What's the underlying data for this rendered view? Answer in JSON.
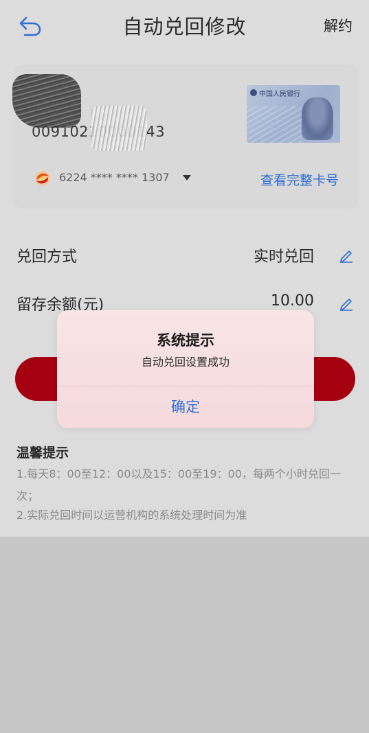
{
  "header": {
    "title": "自动兑回修改",
    "action_label": "解约",
    "back_icon": "back-arrow-icon"
  },
  "card": {
    "account_number": "00910210000143",
    "bank_card_text": "中国人民银行",
    "masked_card": "6224 **** **** 1307",
    "view_full_label": "查看完整卡号",
    "bank_logo_icon": "bank-logo-icon"
  },
  "settings": {
    "method_label": "兑回方式",
    "method_value": "实时兑回",
    "reserve_label": "留存余额(元)",
    "reserve_value": "10.00"
  },
  "tips": {
    "title": "温馨提示",
    "line1": "1.每天8：00至12：00以及15：00至19：00，每两个小时兑回一次；",
    "line2": "2.实际兑回时间以运营机构的系统处理时间为准"
  },
  "dialog": {
    "title": "系统提示",
    "message": "自动兑回设置成功",
    "confirm_label": "确定"
  },
  "colors": {
    "accent_blue": "#2f6fd4",
    "primary_red": "#a50010",
    "overlay_gray": "#dcdcdc"
  }
}
